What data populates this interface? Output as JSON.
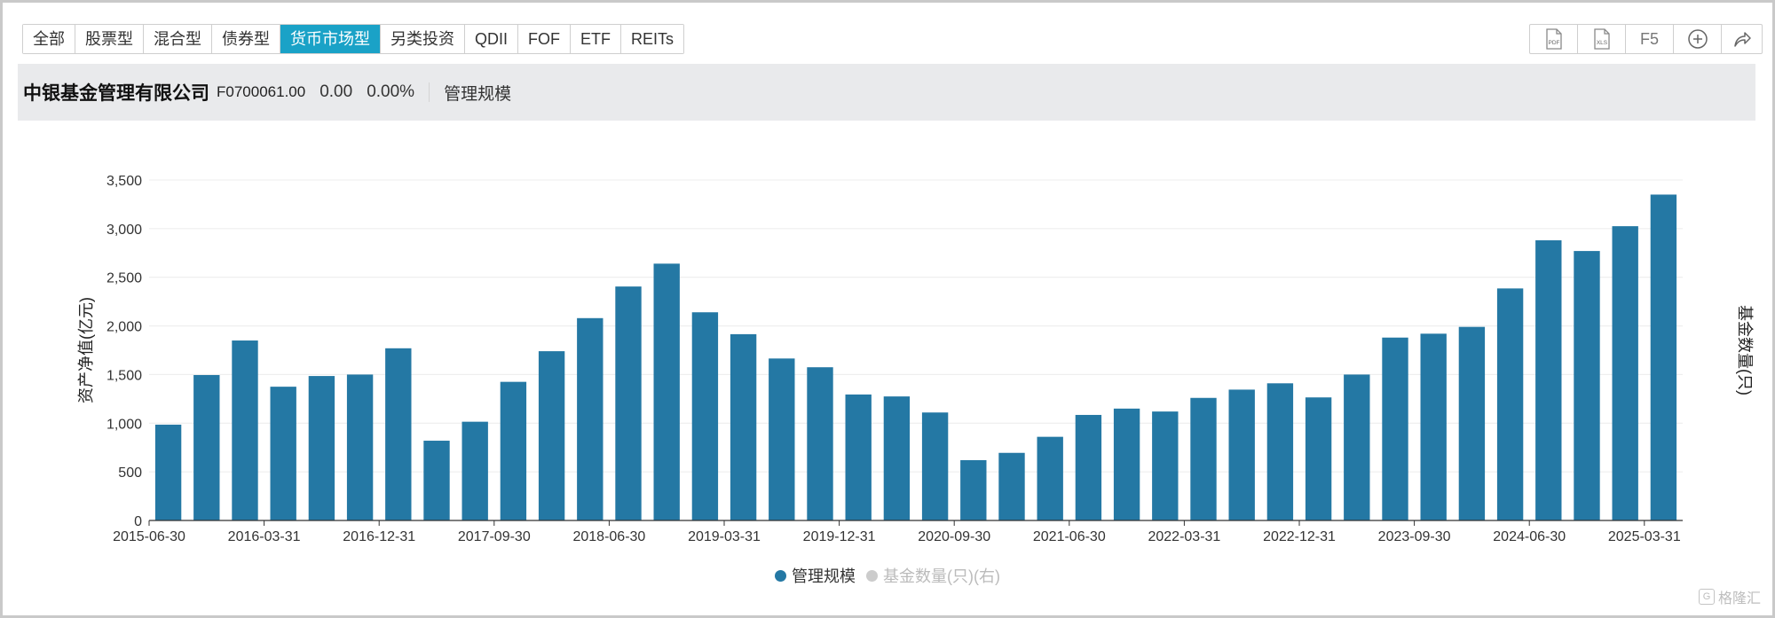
{
  "tabs": [
    {
      "label": "全部",
      "active": false
    },
    {
      "label": "股票型",
      "active": false
    },
    {
      "label": "混合型",
      "active": false
    },
    {
      "label": "债券型",
      "active": false
    },
    {
      "label": "货币市场型",
      "active": true
    },
    {
      "label": "另类投资",
      "active": false
    },
    {
      "label": "QDII",
      "active": false
    },
    {
      "label": "FOF",
      "active": false
    },
    {
      "label": "ETF",
      "active": false
    },
    {
      "label": "REITs",
      "active": false
    }
  ],
  "tools": {
    "pdf_label": "PDF",
    "xls_label": "XLS",
    "f5_label": "F5"
  },
  "info": {
    "company": "中银基金管理有限公司",
    "code": "F0700061.00",
    "value": "0.00",
    "percent": "0.00%",
    "metric": "管理规模"
  },
  "colors": {
    "bar": "#2478a4",
    "active_tab": "#1aa2c7",
    "legend_inactive": "#cccccc"
  },
  "chart_data": {
    "type": "bar",
    "ylabel": "资产净值(亿元)",
    "y2label": "基金数量(只)",
    "ylim": [
      0,
      3500
    ],
    "yticks": [
      0,
      500,
      1000,
      1500,
      2000,
      2500,
      3000,
      3500
    ],
    "ytick_labels": [
      "0",
      "500",
      "1,000",
      "1,500",
      "2,000",
      "2,500",
      "3,000",
      "3,500"
    ],
    "grid": true,
    "legend_position": "bottom",
    "categories": [
      "2015-06-30",
      "2015-09-30",
      "2015-12-31",
      "2016-03-31",
      "2016-06-30",
      "2016-09-30",
      "2016-12-31",
      "2017-03-31",
      "2017-06-30",
      "2017-09-30",
      "2017-12-31",
      "2018-03-31",
      "2018-06-30",
      "2018-09-30",
      "2018-12-31",
      "2019-03-31",
      "2019-06-30",
      "2019-09-30",
      "2019-12-31",
      "2020-03-31",
      "2020-06-30",
      "2020-09-30",
      "2020-12-31",
      "2021-03-31",
      "2021-06-30",
      "2021-09-30",
      "2021-12-31",
      "2022-03-31",
      "2022-06-30",
      "2022-09-30",
      "2022-12-31",
      "2023-03-31",
      "2023-06-30",
      "2023-09-30",
      "2023-12-31",
      "2024-03-31",
      "2024-06-30",
      "2024-09-30",
      "2024-12-31",
      "2025-03-31"
    ],
    "xtick_labels": [
      "2015-06-30",
      "2016-03-31",
      "2016-12-31",
      "2017-09-30",
      "2018-06-30",
      "2019-03-31",
      "2019-12-31",
      "2020-09-30",
      "2021-06-30",
      "2022-03-31",
      "2022-12-31",
      "2023-09-30",
      "2024-06-30",
      "2025-03-31"
    ],
    "series": [
      {
        "name": "管理规模",
        "values": [
          985,
          1495,
          1850,
          1375,
          1485,
          1500,
          1770,
          820,
          1015,
          1425,
          1740,
          2080,
          2405,
          2640,
          2140,
          1915,
          1665,
          1575,
          1295,
          1275,
          1110,
          620,
          695,
          860,
          1085,
          1150,
          1120,
          1260,
          1345,
          1410,
          1265,
          1500,
          1880,
          1920,
          1990,
          2385,
          2880,
          2770,
          3025,
          3350
        ]
      },
      {
        "name": "基金数量(只)(右)",
        "values": []
      }
    ]
  }
}
